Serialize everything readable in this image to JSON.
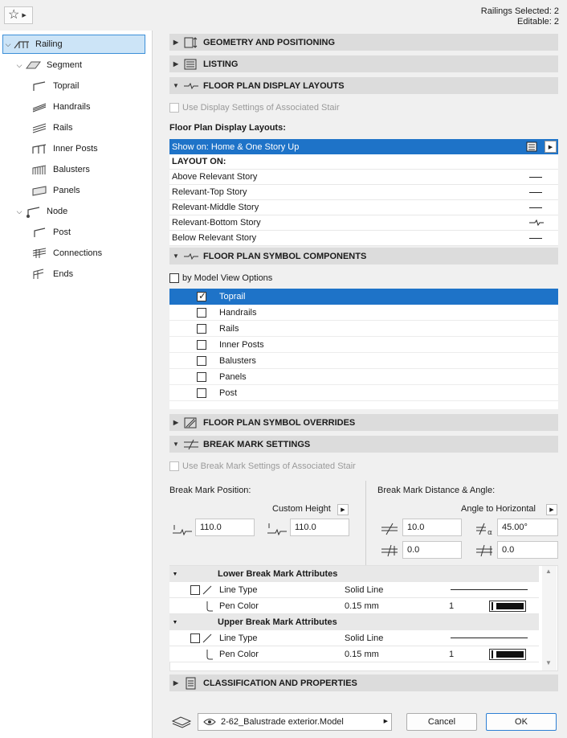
{
  "header": {
    "selected": "Railings Selected: 2",
    "editable": "Editable: 2"
  },
  "tree": [
    {
      "label": "Railing",
      "selected": true
    },
    {
      "label": "Segment"
    },
    {
      "label": "Toprail"
    },
    {
      "label": "Handrails"
    },
    {
      "label": "Rails"
    },
    {
      "label": "Inner Posts"
    },
    {
      "label": "Balusters"
    },
    {
      "label": "Panels"
    },
    {
      "label": "Node"
    },
    {
      "label": "Post"
    },
    {
      "label": "Connections"
    },
    {
      "label": "Ends"
    }
  ],
  "sections": {
    "geometry": "GEOMETRY AND POSITIONING",
    "listing": "LISTING",
    "fpdl": "FLOOR PLAN DISPLAY LAYOUTS",
    "fpsc": "FLOOR PLAN SYMBOL COMPONENTS",
    "fpso": "FLOOR PLAN SYMBOL OVERRIDES",
    "bms": "BREAK MARK SETTINGS",
    "cap": "CLASSIFICATION AND PROPERTIES"
  },
  "fpdl": {
    "use_stair": "Use Display Settings of Associated Stair",
    "layouts_label": "Floor Plan Display Layouts:",
    "show_on": "Show on: Home & One Story Up",
    "layout_on": "LAYOUT ON:",
    "stories": [
      "Above Relevant Story",
      "Relevant-Top Story",
      "Relevant-Middle Story",
      "Relevant-Bottom Story",
      "Below Relevant Story"
    ]
  },
  "fpsc": {
    "by_mvo": "by Model View Options",
    "components": [
      {
        "label": "Toprail",
        "checked": true
      },
      {
        "label": "Handrails",
        "checked": false
      },
      {
        "label": "Rails",
        "checked": false
      },
      {
        "label": "Inner Posts",
        "checked": false
      },
      {
        "label": "Balusters",
        "checked": false
      },
      {
        "label": "Panels",
        "checked": false
      },
      {
        "label": "Post",
        "checked": false
      }
    ]
  },
  "bms": {
    "use_stair": "Use Break Mark Settings of Associated Stair",
    "position_label": "Break Mark Position:",
    "distance_label": "Break Mark Distance & Angle:",
    "custom_height": "Custom Height",
    "angle_to_horizontal": "Angle to Horizontal",
    "pos1": "110.0",
    "pos2": "110.0",
    "dist1": "10.0",
    "angle": "45.00°",
    "dist2": "0.0",
    "dist3": "0.0",
    "lower_title": "Lower Break Mark Attributes",
    "upper_title": "Upper Break Mark Attributes",
    "line_type": "Line Type",
    "line_type_value": "Solid Line",
    "pen_color": "Pen Color",
    "pen_value": "0.15 mm",
    "pen_num": "1"
  },
  "footer": {
    "view": "2-62_Balustrade exterior.Model",
    "cancel": "Cancel",
    "ok": "OK"
  }
}
